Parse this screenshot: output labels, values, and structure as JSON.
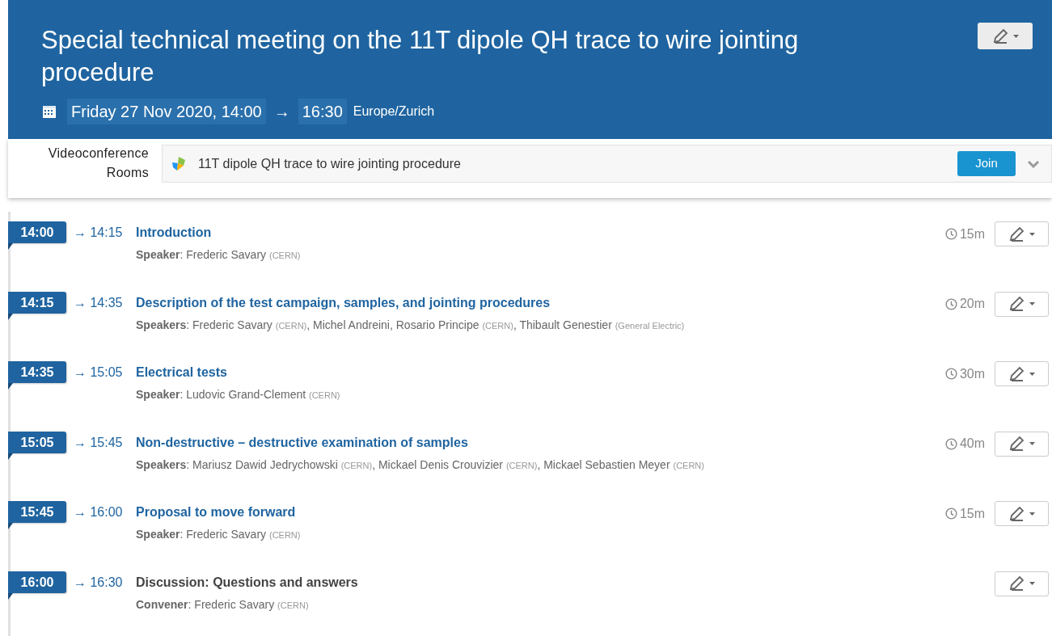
{
  "event": {
    "title": "Special technical meeting on the 11T dipole QH trace to wire jointing procedure",
    "date_start": "Friday 27 Nov 2020, 14:00",
    "arrow": "→",
    "date_end": "16:30",
    "timezone": "Europe/Zurich"
  },
  "videoconference": {
    "label": "Videoconference Rooms",
    "room": "11T dipole QH trace to wire jointing procedure",
    "join": "Join"
  },
  "timetable": [
    {
      "kind": "talk",
      "start": "14:00",
      "end": "→ 14:15",
      "title": "Introduction",
      "duration": "15m",
      "people": [
        {
          "text": "**Speaker**: Frederic Savary "
        },
        {
          "kind": "affiliation",
          "text": "(CERN)"
        }
      ]
    },
    {
      "kind": "talk",
      "start": "14:15",
      "end": "→ 14:35",
      "title": "Description of the test campaign, samples, and jointing procedures",
      "duration": "20m",
      "people": [
        {
          "text": "**Speakers**: Frederic Savary "
        },
        {
          "kind": "affiliation",
          "text": "(CERN)"
        },
        {
          "text": ", Michel Andreini, Rosario Principe "
        },
        {
          "kind": "affiliation",
          "text": "(CERN)"
        },
        {
          "text": ", Thibault Genestier "
        },
        {
          "kind": "affiliation",
          "text": "(General Electric)"
        }
      ]
    },
    {
      "kind": "talk",
      "start": "14:35",
      "end": "→ 15:05",
      "title": "Electrical tests",
      "duration": "30m",
      "people": [
        {
          "text": "**Speaker**: Ludovic Grand-Clement "
        },
        {
          "kind": "affiliation",
          "text": "(CERN)"
        }
      ]
    },
    {
      "kind": "talk",
      "start": "15:05",
      "end": "→ 15:45",
      "title": "Non-destructive – destructive examination of samples",
      "duration": "40m",
      "people": [
        {
          "text": "**Speakers**: Mariusz Dawid Jedrychowski "
        },
        {
          "kind": "affiliation",
          "text": "(CERN)"
        },
        {
          "text": ", Mickael Denis Crouvizier "
        },
        {
          "kind": "affiliation",
          "text": "(CERN)"
        },
        {
          "text": ", Mickael Sebastien Meyer "
        },
        {
          "kind": "affiliation",
          "text": "(CERN)"
        }
      ]
    },
    {
      "kind": "talk",
      "start": "15:45",
      "end": "→ 16:00",
      "title": "Proposal to move forward",
      "duration": "15m",
      "people": [
        {
          "text": "**Speaker**: Frederic Savary "
        },
        {
          "kind": "affiliation",
          "text": "(CERN)"
        }
      ]
    },
    {
      "kind": "session",
      "start": "16:00",
      "end": "→ 16:30",
      "title": "Discussion: Questions and answers",
      "people": [
        {
          "text": "**Convener**: Frederic Savary "
        },
        {
          "kind": "affiliation",
          "text": "(CERN)"
        }
      ]
    }
  ]
}
